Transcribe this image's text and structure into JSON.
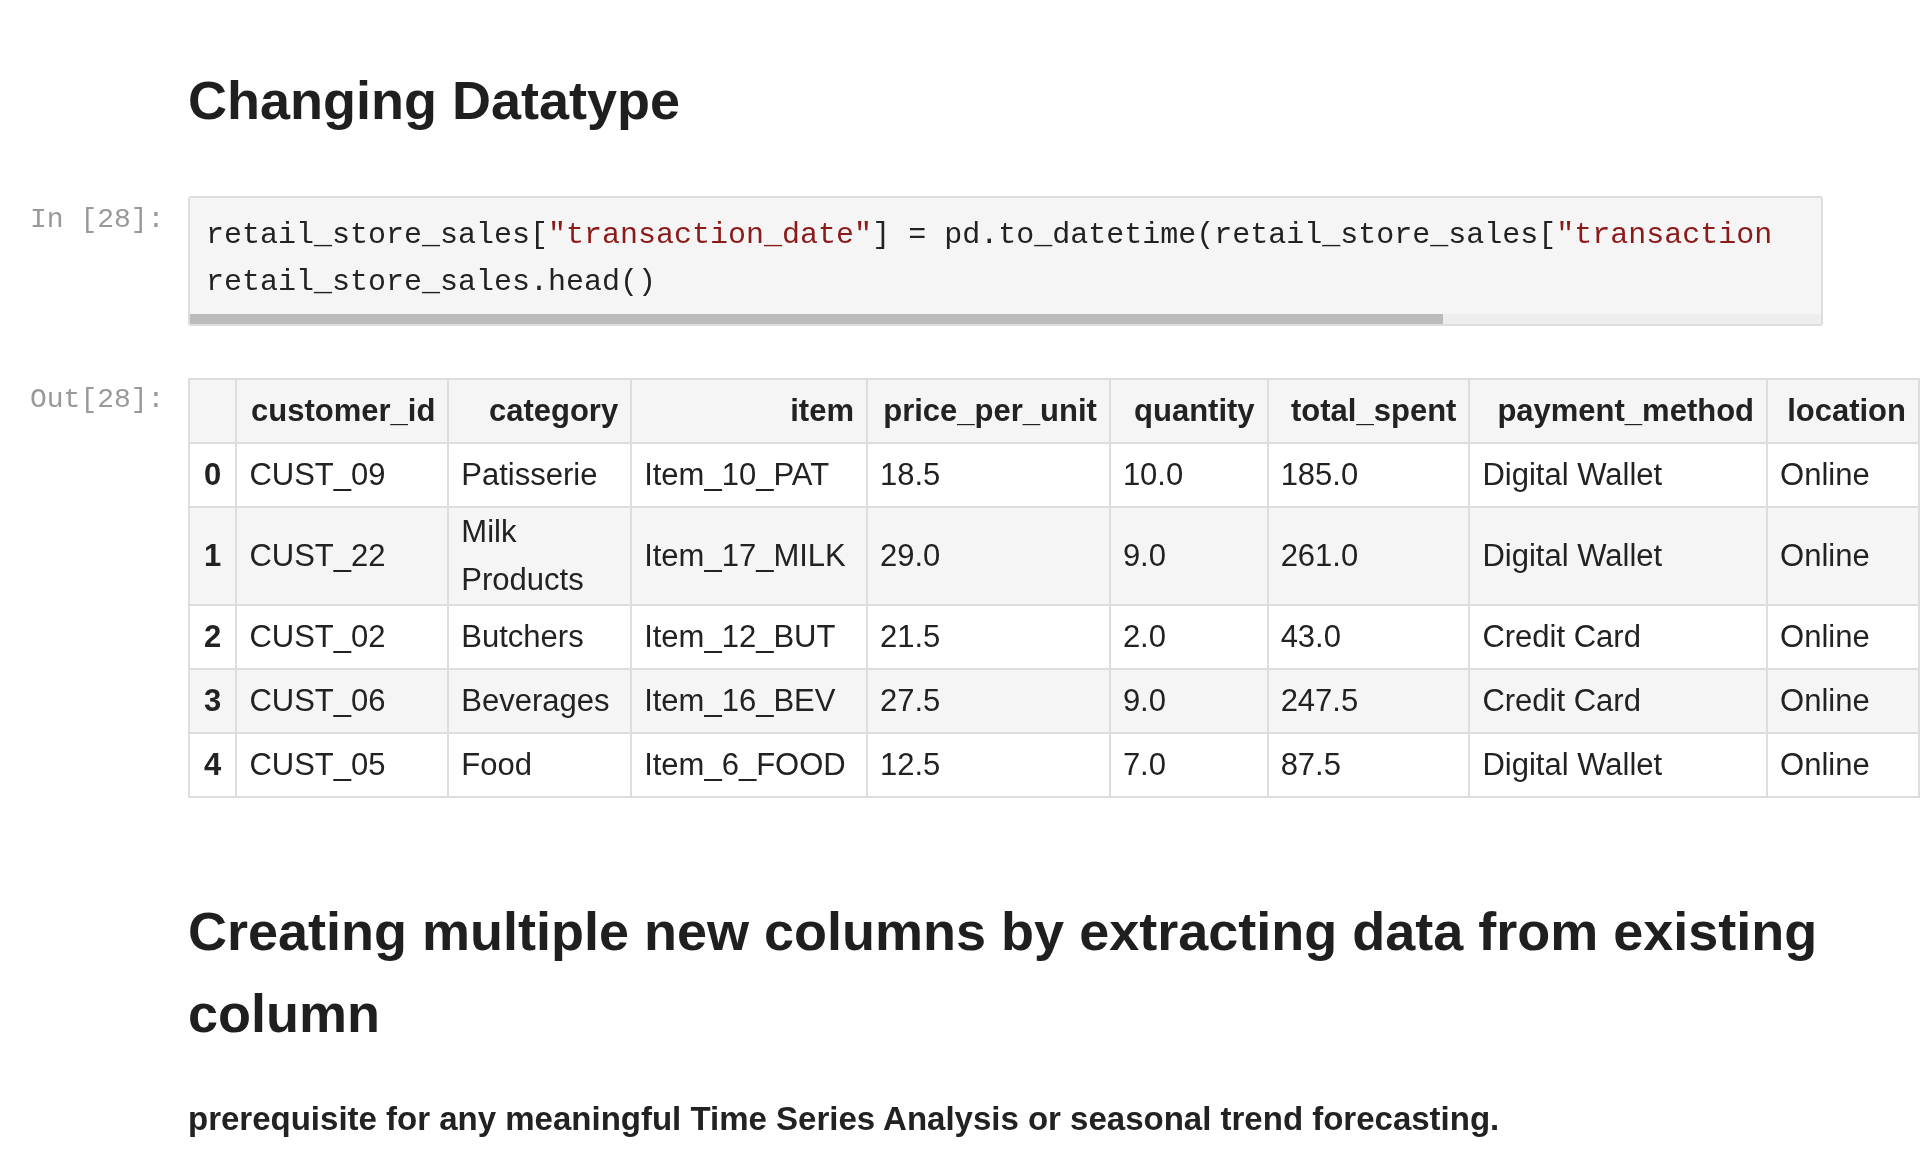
{
  "heading": "Changing Datatype",
  "input_cell": {
    "prompt": "In [28]:",
    "lines": [
      [
        {
          "kind": "code",
          "text": "retail_store_sales["
        },
        {
          "kind": "string",
          "text": "\"transaction_date\""
        },
        {
          "kind": "code",
          "text": "] = pd.to_datetime(retail_store_sales["
        },
        {
          "kind": "string",
          "text": "\"transaction"
        }
      ],
      [
        {
          "kind": "code",
          "text": "retail_store_sales.head()"
        }
      ]
    ]
  },
  "output_cell": {
    "prompt": "Out[28]:",
    "table": {
      "columns": [
        "customer_id",
        "category",
        "item",
        "price_per_unit",
        "quantity",
        "total_spent",
        "payment_method",
        "location"
      ],
      "rows": [
        {
          "index": "0",
          "cells": [
            "CUST_09",
            "Patisserie",
            "Item_10_PAT",
            "18.5",
            "10.0",
            "185.0",
            "Digital Wallet",
            "Online"
          ]
        },
        {
          "index": "1",
          "cells": [
            "CUST_22",
            "Milk Products",
            "Item_17_MILK",
            "29.0",
            "9.0",
            "261.0",
            "Digital Wallet",
            "Online"
          ]
        },
        {
          "index": "2",
          "cells": [
            "CUST_02",
            "Butchers",
            "Item_12_BUT",
            "21.5",
            "2.0",
            "43.0",
            "Credit Card",
            "Online"
          ]
        },
        {
          "index": "3",
          "cells": [
            "CUST_06",
            "Beverages",
            "Item_16_BEV",
            "27.5",
            "9.0",
            "247.5",
            "Credit Card",
            "Online"
          ]
        },
        {
          "index": "4",
          "cells": [
            "CUST_05",
            "Food",
            "Item_6_FOOD",
            "12.5",
            "7.0",
            "87.5",
            "Digital Wallet",
            "Online"
          ]
        }
      ]
    }
  },
  "heading_2": "Creating multiple new columns by extracting data from existing column",
  "paragraph": "prerequisite for any meaningful Time Series Analysis or seasonal trend forecasting."
}
